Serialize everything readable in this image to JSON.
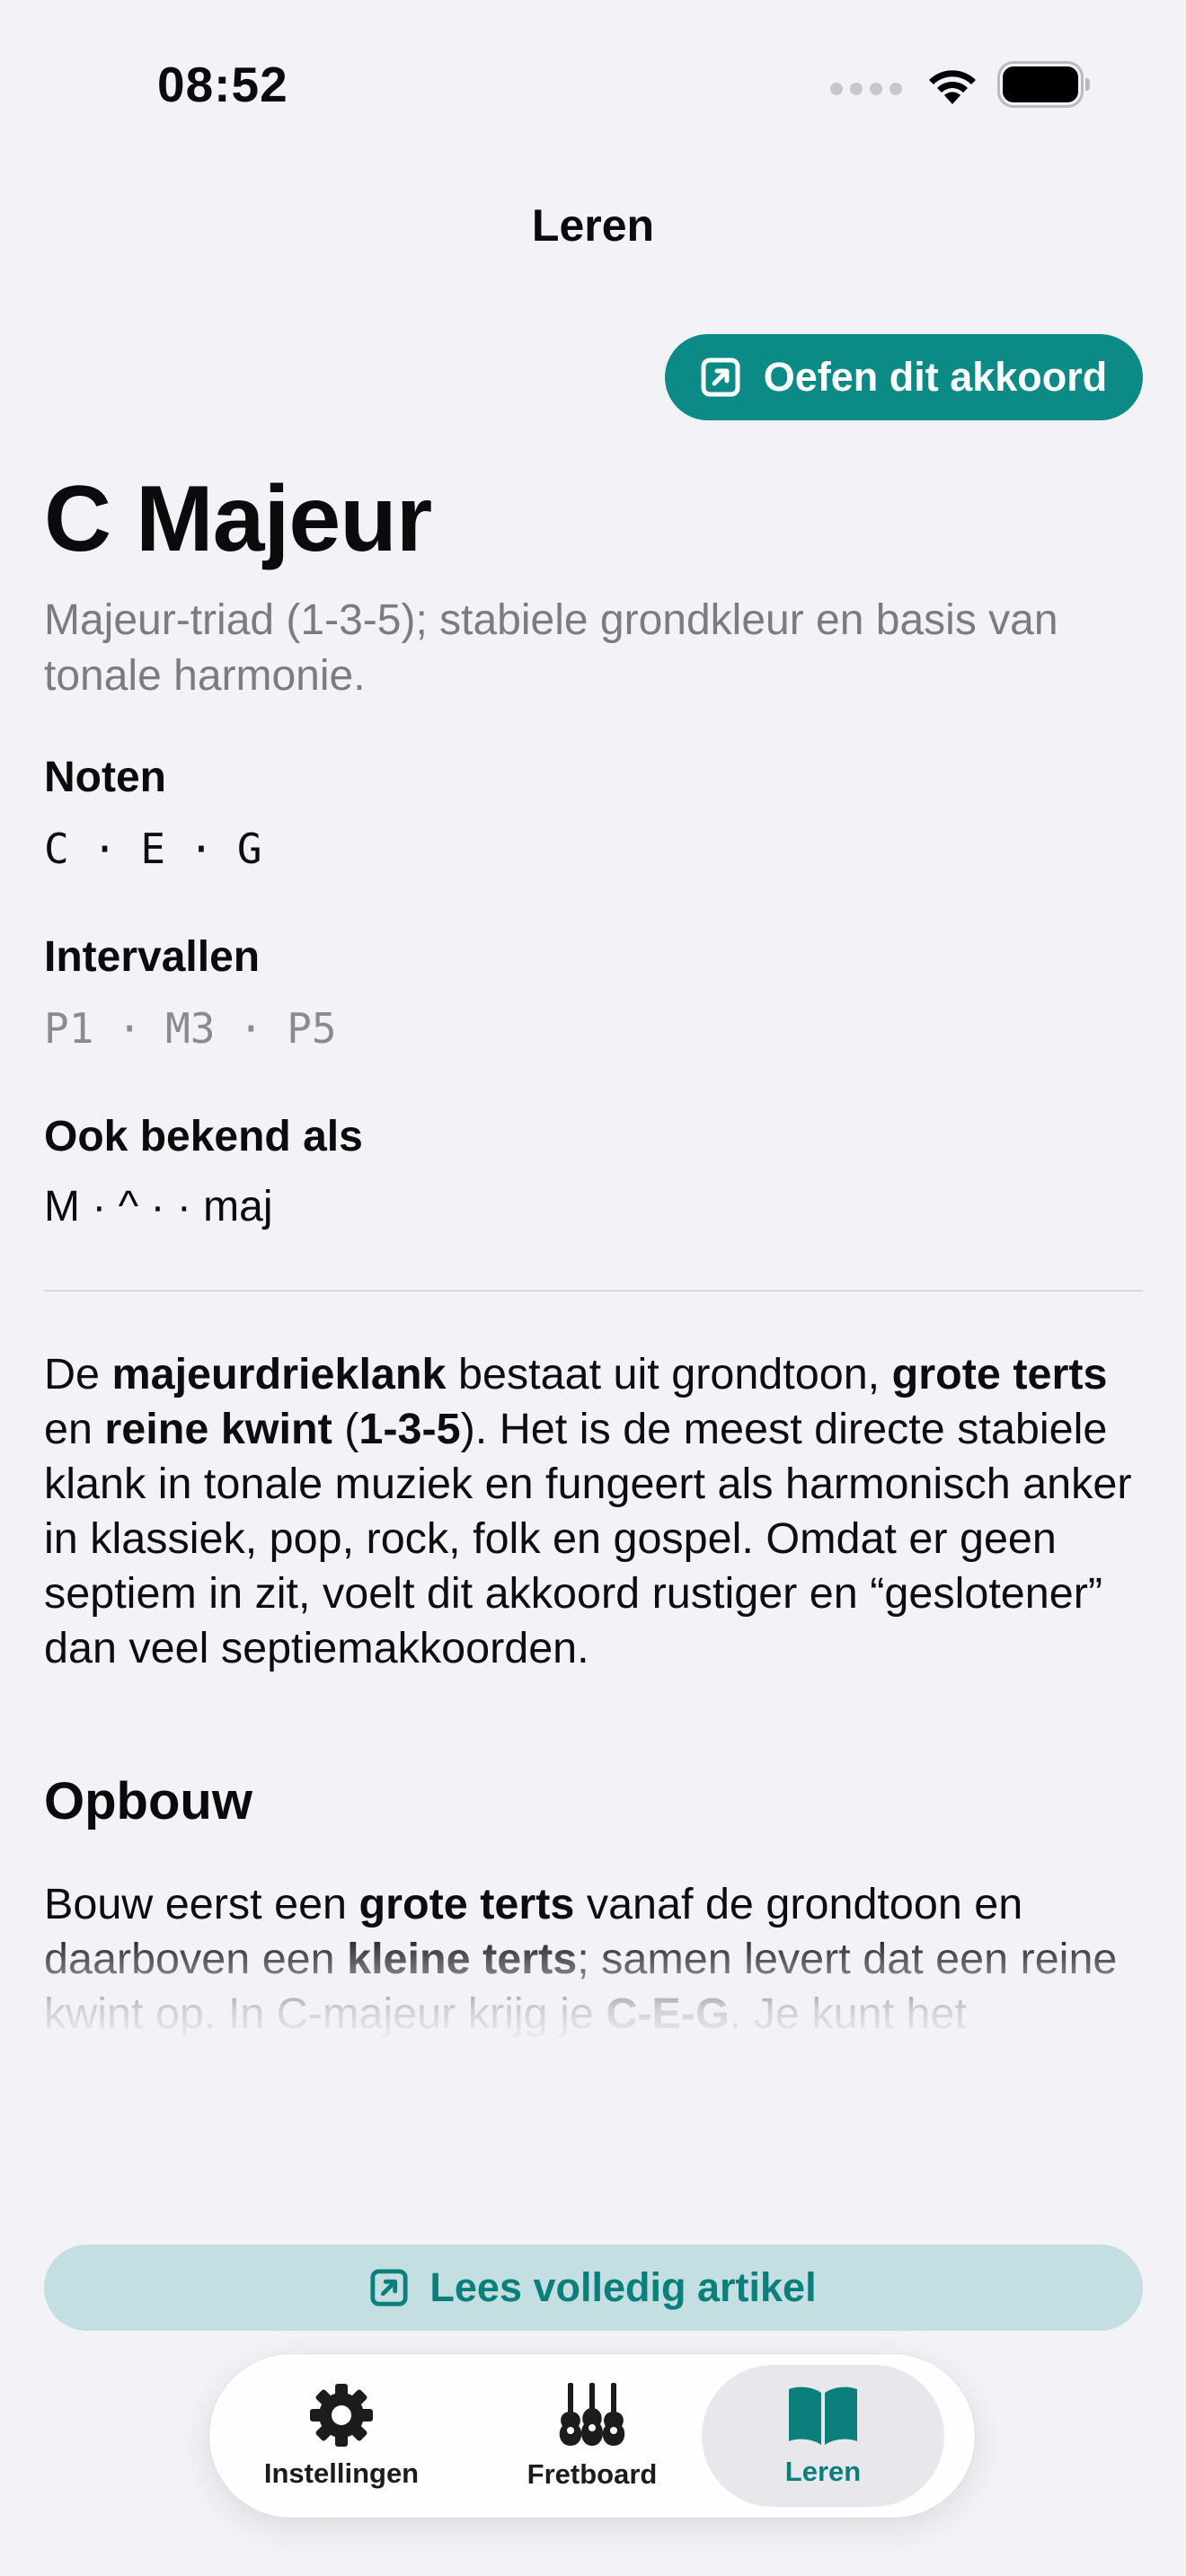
{
  "status_bar": {
    "time": "08:52"
  },
  "nav": {
    "title": "Leren"
  },
  "practice_button": {
    "label": "Oefen dit akkoord"
  },
  "chord": {
    "title": "C Majeur",
    "subtitle": "Majeur-triad (1-3-5); stabiele grondkleur en basis van tonale harmonie.",
    "notes_label": "Noten",
    "notes": [
      "C",
      "E",
      "G"
    ],
    "intervals_label": "Intervallen",
    "intervals": [
      "P1",
      "M3",
      "P5"
    ],
    "aliases_label": "Ook bekend als",
    "aliases": "M · ^ ·  · maj"
  },
  "article": {
    "intro": {
      "t1": "De ",
      "b1": "majeurdrieklank",
      "t2": " bestaat uit grondtoon, ",
      "b2": "grote terts",
      "t3": " en ",
      "b3": "reine kwint",
      "t4": " (",
      "b4": "1-3-5",
      "t5": "). Het is de meest directe stabiele klank in tonale muziek en fungeert als harmonisch anker in klassiek, pop, rock, folk en gospel. Omdat er geen septiem in zit, voelt dit akkoord rustiger en “geslotener” dan veel septiemakkoorden."
    },
    "section_heading": "Opbouw",
    "section_text": {
      "t1": "Bouw eerst een ",
      "b1": "grote terts",
      "t2": " vanaf de grondtoon en daarboven een ",
      "b2": "kleine terts",
      "t3": "; samen levert dat een reine kwint op. In C-majeur krijg je ",
      "b3": "C-E-G",
      "t4": ". Je kunt het"
    }
  },
  "read_button": {
    "label": "Lees volledig artikel"
  },
  "tabbar": {
    "tabs": [
      {
        "label": "Instellingen",
        "icon": "gear-icon"
      },
      {
        "label": "Fretboard",
        "icon": "guitars-icon"
      },
      {
        "label": "Leren",
        "icon": "book-icon",
        "active": true
      }
    ]
  },
  "colors": {
    "accent": "#0b8a86",
    "accent_light": "#c3dfe1",
    "background": "#f2f2f7",
    "secondary_text": "#7b7b82"
  }
}
